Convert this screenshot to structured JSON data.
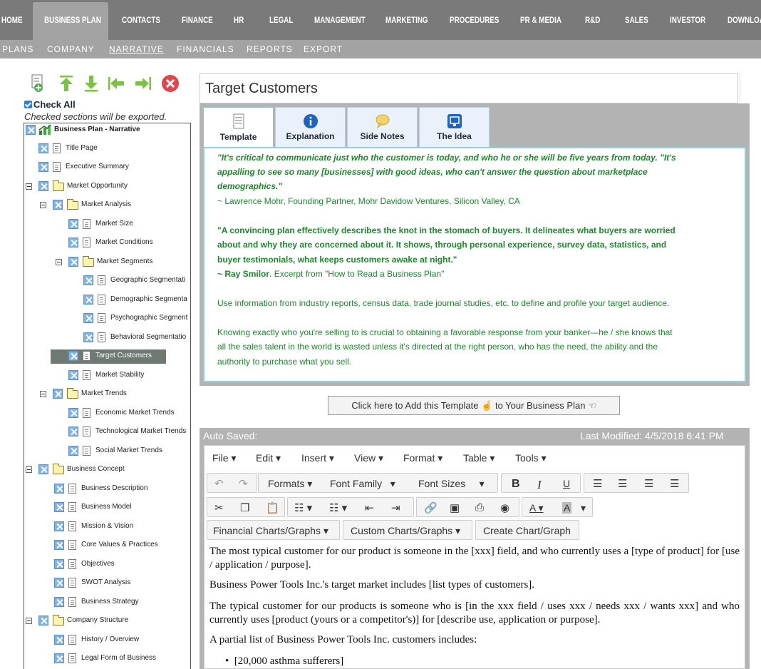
{
  "topnav": {
    "items": [
      "HOME",
      "BUSINESS PLAN",
      "CONTACTS",
      "FINANCE",
      "HR",
      "LEGAL",
      "MANAGEMENT",
      "MARKETING",
      "PROCEDURES",
      "PR & MEDIA",
      "R&D",
      "SALES",
      "INVESTOR",
      "DOWNLOA"
    ],
    "active": "BUSINESS PLAN"
  },
  "subnav": {
    "items": [
      "PLANS",
      "COMPANY",
      "NARRATIVE",
      "FINANCIALS",
      "REPORTS",
      "EXPORT"
    ],
    "active": "NARRATIVE"
  },
  "sidebar": {
    "check_all": "Check All",
    "note": "Checked sections will be exported.",
    "tree": [
      "Business Plan - Narrative",
      "Title Page",
      "Executive Summary",
      "Market Opportunity",
      "Market Analysis",
      "Market Size",
      "Market Conditions",
      "Market Segments",
      "Geographic Segmentati",
      "Demographic Segmenta",
      "Psychographic Segment",
      "Behavioral Segmentatio",
      "Target Customers",
      "Market Stability",
      "Market Trends",
      "Economic Market Trends",
      "Technological Market Trends",
      "Social Market Trends",
      "Business Concept",
      "Business Description",
      "Business Model",
      "Mission & Vision",
      "Core Values & Practices",
      "Objectives",
      "SWOT Analysis",
      "Business Strategy",
      "Company Structure",
      "History / Overview",
      "Legal Form of Business"
    ],
    "selected": "Target Customers"
  },
  "main": {
    "title": "Target Customers",
    "tabs": [
      "Template",
      "Explanation",
      "Side Notes",
      "The Idea"
    ],
    "active_tab": "Template",
    "quote1": [
      "\"It's critical to communicate just who the customer is today, and who he or she will be five years from today. \"It's",
      "appalling to see so many [businesses] with good ideas, who can't answer the question about marketplace",
      "demographics.\""
    ],
    "quote1_attr": "~ Lawrence Mohr, Founding Partner, Mohr Davidow Ventures, Silicon Valley, CA",
    "quote2": [
      "\"A convincing plan effectively describes the knot in the stomach of buyers. It delineates what buyers are worried",
      "about and why they are concerned about it. It shows, through personal experience, survey data, statistics, and",
      "buyer testimonials, what keeps customers awake at night.\""
    ],
    "quote2_attr_name": "~ Ray Smilor",
    "quote2_attr_rest": ". Excerpt from \"How to Read a Business Plan\"",
    "para1": "Use information from industry reports, census data, trade journal studies, etc. to define and profile your target audience.",
    "para2": [
      "Knowing exactly who you're selling to is crucial to obtaining a favorable response from your banker—he / she knows that",
      "all the sales talent in the world is wasted unless it's directed at the right person, who has the need, the ability and the",
      "authority to purchase what you sell."
    ],
    "add_button_pre": "Click here to Add this Template",
    "add_button_post": "to Your Business Plan"
  },
  "editor": {
    "auto_saved": "Auto Saved:",
    "last_modified": "Last Modified: 4/5/2018 6:41 PM",
    "menus": [
      "File",
      "Edit",
      "Insert",
      "View",
      "Format",
      "Table",
      "Tools"
    ],
    "formats": "Formats",
    "font_family": "Font Family",
    "font_sizes": "Font Sizes",
    "bold": "B",
    "italic": "I",
    "underline": "U",
    "font_color": "A",
    "bg_color": "A",
    "financial_charts": "Financial Charts/Graphs",
    "custom_charts": "Custom Charts/Graphs",
    "create_chart": "Create Chart/Graph",
    "body": [
      "The most typical customer for our product is someone in the [xxx] field, and who currently uses a [type of product] for [use / application / purpose].",
      "Business Power Tools Inc.'s target market includes [list types of customers].",
      "The typical customer for our products is someone who is [in the xxx field / uses xxx / needs xxx / wants xxx] and who currently uses [product (yours or a competitor's)] for [describe use, application or purpose].",
      "A partial list of Business Power Tools Inc. customers includes:",
      "[20,000 asthma sufferers]"
    ]
  },
  "colors": {
    "nav": "#7a7a7a",
    "subnav": "#a3a3a3",
    "quote_green": "#1a8a2a",
    "tab_border": "#8fd0e0"
  }
}
